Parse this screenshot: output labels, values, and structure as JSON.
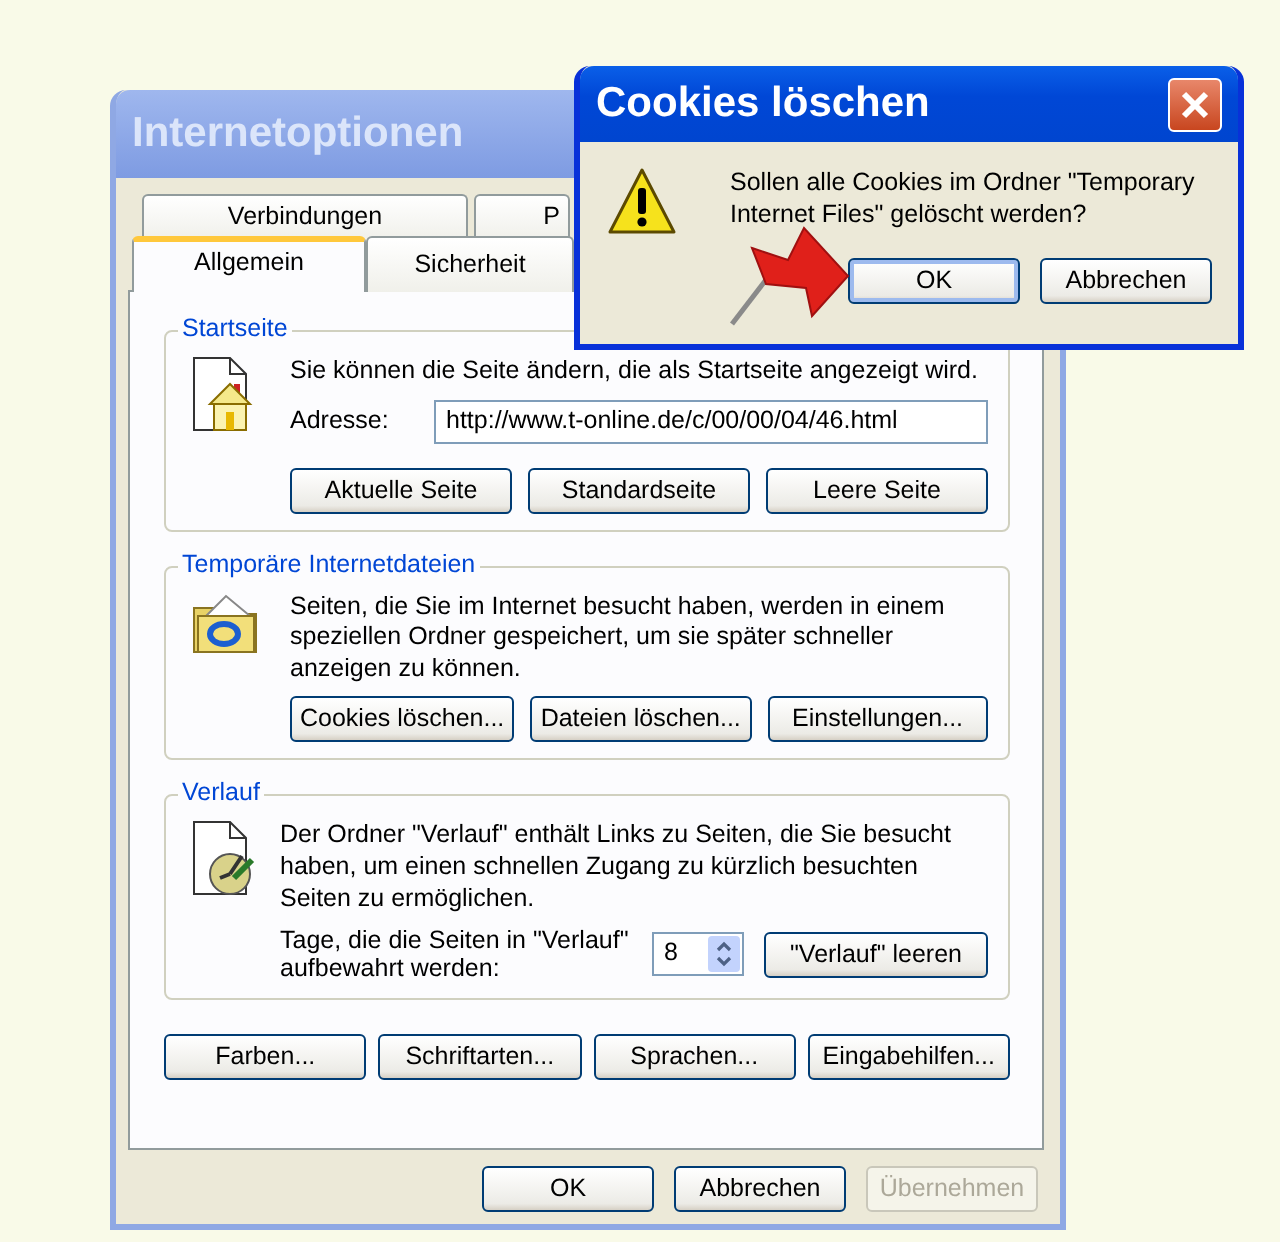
{
  "main_window": {
    "title": "Internetoptionen",
    "active": false,
    "tab_rows": [
      [
        {
          "label": "Verbindungen",
          "selected": false
        },
        {
          "label": "P",
          "selected": false
        }
      ],
      [
        {
          "label": "Allgemein",
          "selected": true
        },
        {
          "label": "Sicherheit",
          "selected": false
        }
      ]
    ],
    "groups": [
      {
        "kind": "homepage",
        "title": "Startseite",
        "text": "Sie können die Seite ändern, die als Startseite angezeigt wird.",
        "address": {
          "label": "Adresse:",
          "value": "http://www.t-online.de/c/00/00/04/46.html"
        },
        "buttons": [
          "Aktuelle Seite",
          "Standardseite",
          "Leere Seite"
        ]
      },
      {
        "kind": "temp-files",
        "title": "Temporäre Internetdateien",
        "text": "Seiten, die Sie im Internet besucht haben, werden in einem speziellen Ordner gespeichert, um sie später schneller anzeigen zu können.",
        "buttons": [
          "Cookies löschen...",
          "Dateien löschen...",
          "Einstellungen..."
        ]
      },
      {
        "kind": "history",
        "title": "Verlauf",
        "text": "Der Ordner \"Verlauf\" enthält Links zu Seiten, die Sie besucht haben, um einen schnellen Zugang zu kürzlich besuchten Seiten zu ermöglichen.",
        "days": {
          "label": "Tage, die die Seiten in \"Verlauf\" aufbewahrt werden:",
          "value": "8"
        },
        "buttons": [
          "\"Verlauf\" leeren"
        ]
      }
    ],
    "buttons": [
      "Farben...",
      "Schriftarten...",
      "Sprachen...",
      "Eingabehilfen..."
    ],
    "footer_buttons": [
      {
        "label": "OK",
        "disabled": false
      },
      {
        "label": "Abbrechen",
        "disabled": false
      },
      {
        "label": "Übernehmen",
        "disabled": true
      }
    ]
  },
  "dialog": {
    "title": "Cookies löschen",
    "active": true,
    "message": "Sollen alle Cookies im Ordner \"Temporary Internet Files\" gelöscht werden?",
    "buttons": [
      {
        "label": "OK",
        "default": true
      },
      {
        "label": "Abbrechen",
        "default": false
      }
    ]
  }
}
